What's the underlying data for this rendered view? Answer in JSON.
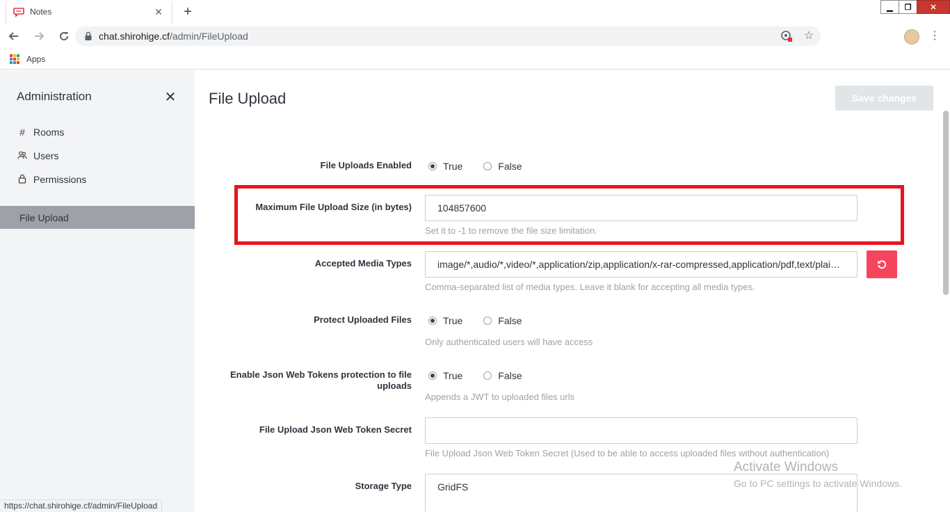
{
  "browser": {
    "tab_title": "Notes",
    "url_host": "chat.shirohige.cf",
    "url_path": "/admin/FileUpload",
    "bookmark_apps": "Apps",
    "status_url": "https://chat.shirohige.cf/admin/FileUpload"
  },
  "sidebar": {
    "title": "Administration",
    "items": [
      {
        "label": "Rooms",
        "icon": "hash-icon"
      },
      {
        "label": "Users",
        "icon": "users-icon"
      },
      {
        "label": "Permissions",
        "icon": "lock-icon"
      }
    ],
    "active_item": "File Upload"
  },
  "main": {
    "title": "File Upload",
    "save_label": "Save changes",
    "settings": {
      "uploads_enabled": {
        "label": "File Uploads Enabled",
        "true_label": "True",
        "false_label": "False",
        "value": true
      },
      "max_size": {
        "label": "Maximum File Upload Size (in bytes)",
        "value": "104857600",
        "hint": "Set it to -1 to remove the file size limitation."
      },
      "media_types": {
        "label": "Accepted Media Types",
        "value": "image/*,audio/*,video/*,application/zip,application/x-rar-compressed,application/pdf,text/plain,application/msword,application/vnd.openxmlformats-officedocument.wordprocessingml.document",
        "hint": "Comma-separated list of media types. Leave it blank for accepting all media types."
      },
      "protect_files": {
        "label": "Protect Uploaded Files",
        "true_label": "True",
        "false_label": "False",
        "value": true,
        "hint": "Only authenticated users will have access"
      },
      "jwt_protection": {
        "label": "Enable Json Web Tokens protection to file uploads",
        "true_label": "True",
        "false_label": "False",
        "value": true,
        "hint": "Appends a JWT to uploaded files urls"
      },
      "jwt_secret": {
        "label": "File Upload Json Web Token Secret",
        "value": "",
        "hint": "File Upload Json Web Token Secret (Used to be able to access uploaded files without authentication)"
      },
      "storage_type": {
        "label": "Storage Type",
        "value": "GridFS"
      }
    }
  },
  "watermark": {
    "line1": "Activate Windows",
    "line2": "Go to PC settings to activate Windows."
  },
  "colors": {
    "highlight": "#e8141f",
    "reset_button": "#f5455c",
    "sidebar_active": "#9ea2a8"
  }
}
